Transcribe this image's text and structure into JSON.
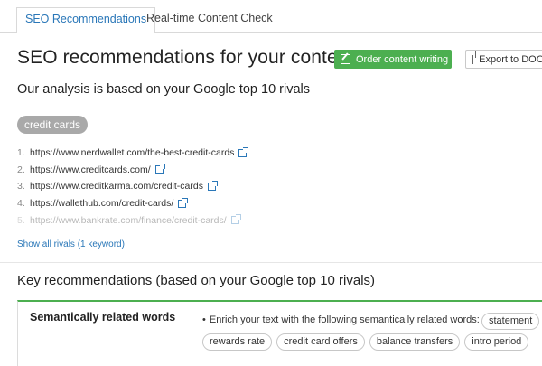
{
  "tabs": [
    {
      "label": "SEO Recommendations",
      "active": true
    },
    {
      "label": "Real-time Content Check",
      "active": false
    }
  ],
  "header": {
    "title": "SEO recommendations for your content",
    "order_button": "Order content writing",
    "export_button": "Export to DOCX"
  },
  "analysis": {
    "subtitle": "Our analysis is based on your Google top 10 rivals",
    "keyword_tag": "credit cards",
    "rivals": [
      {
        "num": "1.",
        "url": "https://www.nerdwallet.com/the-best-credit-cards"
      },
      {
        "num": "2.",
        "url": "https://www.creditcards.com/"
      },
      {
        "num": "3.",
        "url": "https://www.creditkarma.com/credit-cards"
      },
      {
        "num": "4.",
        "url": "https://wallethub.com/credit-cards/"
      },
      {
        "num": "5.",
        "url": "https://www.bankrate.com/finance/credit-cards/"
      }
    ],
    "show_all_link": "Show all rivals (1 keyword)"
  },
  "key_recommendations": {
    "title": "Key recommendations (based on your Google top 10 rivals)",
    "rows": [
      {
        "label": "Semantically related words",
        "text": "Enrich your text with the following semantically related words:",
        "words": [
          "statement",
          "rewards rate",
          "credit card offers",
          "balance transfers",
          "intro period"
        ]
      }
    ]
  },
  "colors": {
    "accent_blue": "#2a77b8",
    "accent_green": "#4caf50",
    "tag_gray": "#a9a9a9"
  },
  "icons": {
    "order": "edit-icon",
    "export": "export-icon",
    "external": "external-link-icon"
  }
}
